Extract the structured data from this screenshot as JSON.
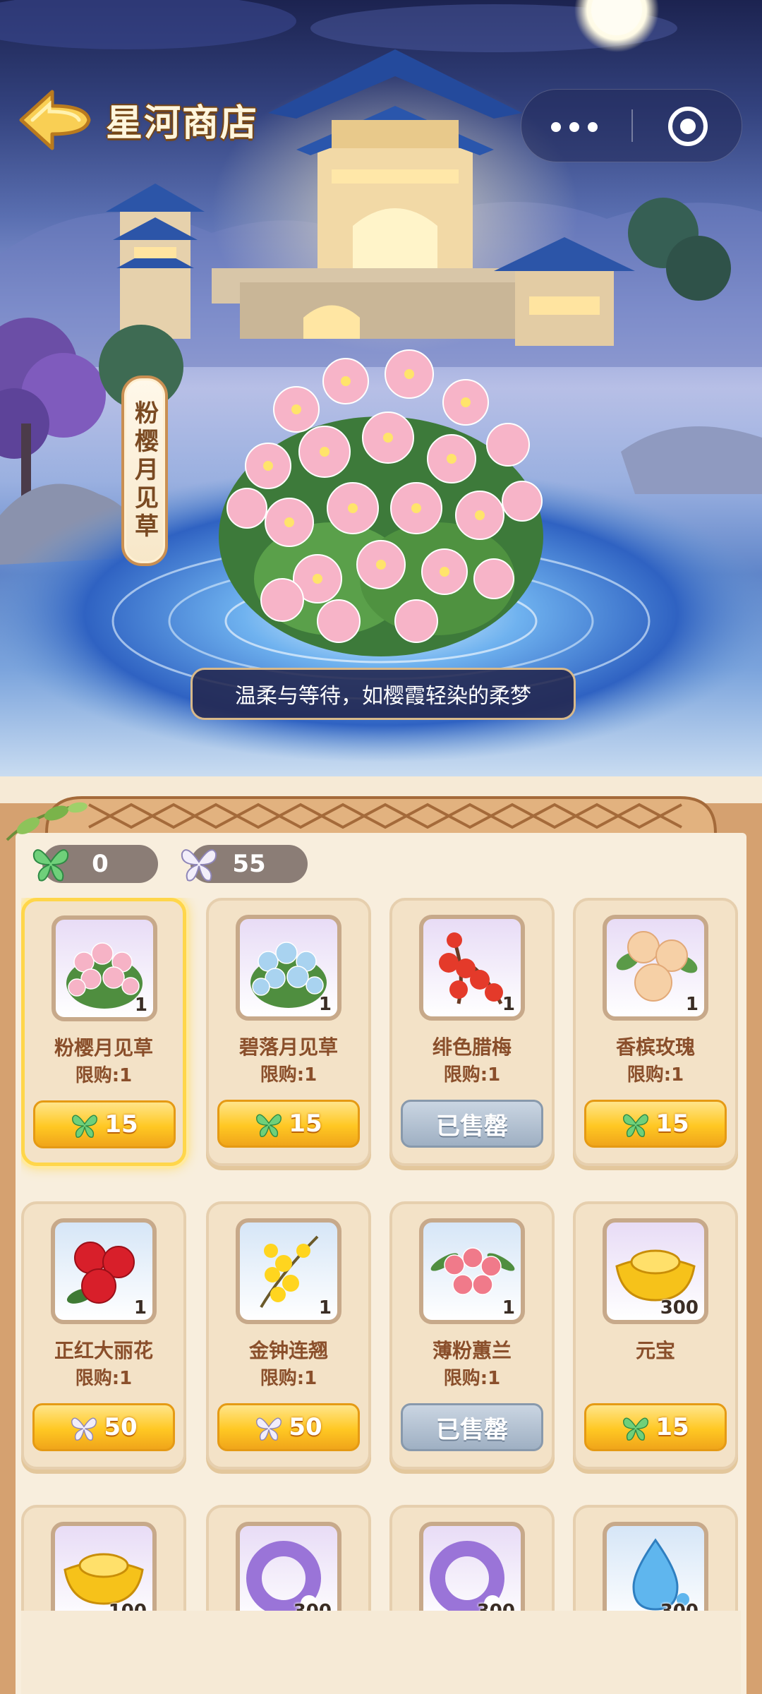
{
  "header": {
    "title": "星河商店",
    "icons": {
      "back": "arrow-left-icon",
      "more": "more-dots-icon",
      "close": "target-circle-icon"
    }
  },
  "hero": {
    "featured_name": "粉樱月见草",
    "tagline": "温柔与等待，如樱霞轻染的柔梦"
  },
  "currency": [
    {
      "icon": "green-butterfly-icon",
      "value": "0"
    },
    {
      "icon": "white-butterfly-icon",
      "value": "55"
    }
  ],
  "items": [
    {
      "name": "粉樱月见草",
      "limit": "限购:1",
      "qty": "1",
      "price": "15",
      "currency": "green",
      "sold_label": "",
      "selected": true
    },
    {
      "name": "碧落月见草",
      "limit": "限购:1",
      "qty": "1",
      "price": "15",
      "currency": "green",
      "sold_label": ""
    },
    {
      "name": "绯色腊梅",
      "limit": "限购:1",
      "qty": "1",
      "price": "",
      "currency": "",
      "sold_label": "已售罄"
    },
    {
      "name": "香槟玫瑰",
      "limit": "限购:1",
      "qty": "1",
      "price": "15",
      "currency": "green",
      "sold_label": ""
    },
    {
      "name": "正红大丽花",
      "limit": "限购:1",
      "qty": "1",
      "price": "50",
      "currency": "white",
      "sold_label": ""
    },
    {
      "name": "金钟连翘",
      "limit": "限购:1",
      "qty": "1",
      "price": "50",
      "currency": "white",
      "sold_label": ""
    },
    {
      "name": "薄粉蕙兰",
      "limit": "限购:1",
      "qty": "1",
      "price": "",
      "currency": "",
      "sold_label": "已售罄"
    },
    {
      "name": "元宝",
      "limit": "",
      "qty": "300",
      "price": "15",
      "currency": "green",
      "sold_label": ""
    },
    {
      "name": "",
      "limit": "",
      "qty": "100",
      "price": "",
      "currency": "",
      "sold_label": ""
    },
    {
      "name": "",
      "limit": "",
      "qty": "300",
      "price": "",
      "currency": "",
      "sold_label": ""
    },
    {
      "name": "",
      "limit": "",
      "qty": "300",
      "price": "",
      "currency": "",
      "sold_label": ""
    },
    {
      "name": "",
      "limit": "",
      "qty": "300",
      "price": "",
      "currency": "",
      "sold_label": ""
    }
  ],
  "colors": {
    "accent_gold": "#ffc823",
    "sold_gray": "#9fb0c3",
    "name_brown": "#8a4f2b"
  }
}
